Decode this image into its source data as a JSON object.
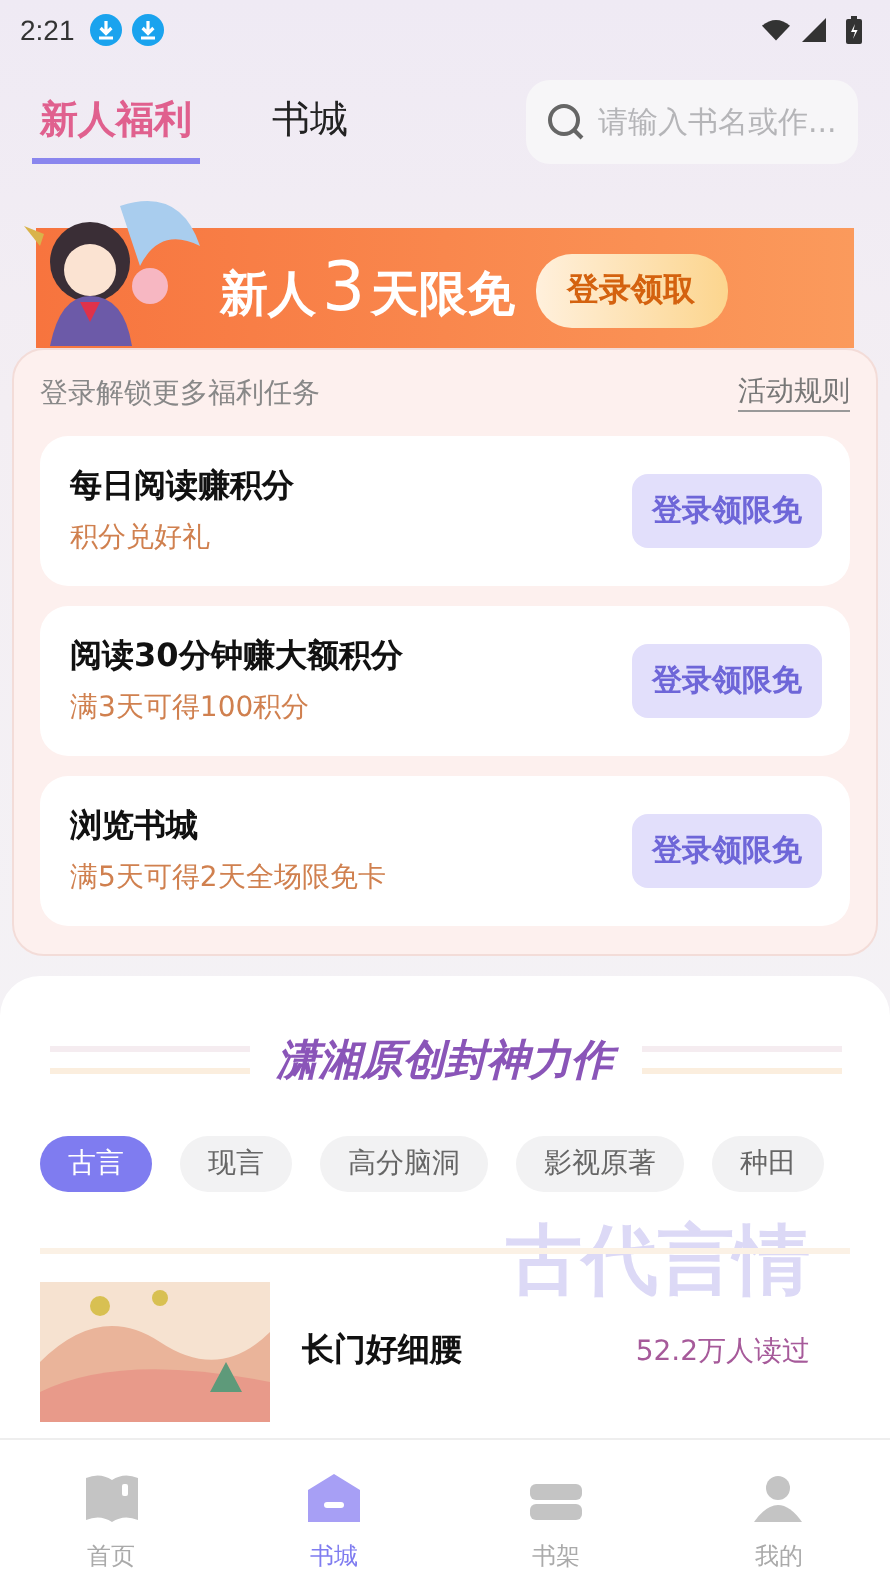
{
  "status_bar": {
    "time": "2:21",
    "notifications": [
      {
        "kind": "download"
      },
      {
        "kind": "download"
      }
    ]
  },
  "tabs": [
    {
      "label": "新人福利",
      "selected": true
    },
    {
      "label": "书城",
      "selected": false
    }
  ],
  "search": {
    "placeholder": "请输入书名或作..."
  },
  "banner": {
    "title_parts": [
      "新人",
      "3",
      "天限免"
    ],
    "button": "登录领取",
    "art": {
      "kind": "picture"
    }
  },
  "welfare": {
    "subtitle": "登录解锁更多福利任务",
    "rules_link": "活动规则",
    "tasks": [
      {
        "title": "每日阅读赚积分",
        "reward": "积分兑好礼",
        "button": "登录领限免"
      },
      {
        "title": "阅读30分钟赚大额积分",
        "reward": "满3天可得100积分",
        "button": "登录领限免"
      },
      {
        "title": "浏览书城",
        "reward": "满5天可得2天全场限免卡",
        "button": "登录领限免"
      }
    ]
  },
  "featured": {
    "heading": "潇湘原创封神力作",
    "genres": [
      {
        "label": "古言",
        "selected": true
      },
      {
        "label": "现言",
        "selected": false
      },
      {
        "label": "高分脑洞",
        "selected": false
      },
      {
        "label": "影视原著",
        "selected": false
      },
      {
        "label": "种田",
        "selected": false
      }
    ],
    "genre_backdrop": "古代言情",
    "books": [
      {
        "title": "长门好细腰",
        "reads": "52.2万人读过",
        "cover": {
          "kind": "picture"
        }
      }
    ]
  },
  "bottom_nav": [
    {
      "label": "首页",
      "selected": false
    },
    {
      "label": "书城",
      "selected": true
    },
    {
      "label": "书架",
      "selected": false
    },
    {
      "label": "我的",
      "selected": false
    }
  ]
}
